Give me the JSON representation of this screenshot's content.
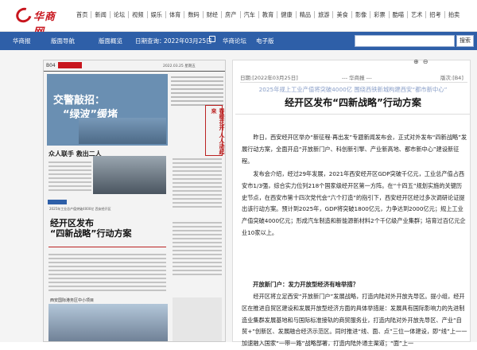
{
  "site": {
    "logo_text": "华商网"
  },
  "top_nav": [
    "首页",
    "新闻",
    "论坛",
    "视频",
    "娱乐",
    "体育",
    "数码",
    "财经",
    "房产",
    "汽车",
    "教育",
    "健康",
    "精品",
    "旅游",
    "美食",
    "影像",
    "彩票",
    "酷喵",
    "艺术",
    "招考",
    "拍卖"
  ],
  "sub_nav": {
    "items": [
      "华商报",
      "版面导航",
      "版面概览"
    ],
    "date_label": "日期查询：",
    "date_value": "2022年03月25日",
    "date_icon": "calendar-icon",
    "links": [
      "华商论坛",
      "电子版"
    ],
    "search_button": "搜索",
    "search_placeholder": ""
  },
  "newspaper": {
    "page_no": "B04",
    "date": "2022.03.25 星期五",
    "story1_title_a": "交警敲招：",
    "story1_title_b": "“绿波”缓堵",
    "side_banner": "春暖花开 人人动起来",
    "story2_title": "众人联手 救出二人",
    "story3_head": "2025年工业总产值突破4000亿 西安经开区",
    "story3_title_a": "经开区发布",
    "story3_title_b": "“四新战略”行动方案",
    "story4_title": "西安国际港务区中小项目"
  },
  "viewer_controls": [
    "⊕",
    "⊖"
  ],
  "article": {
    "date": "日期:[2022年03月25日]",
    "source": "--- 华商报 ---",
    "page": "版次:[B4]",
    "pretitle": "2025年规上工业产值将突破4000亿 围绕西铁新城构建西安“都市新中心”",
    "title": "经开区发布“四新战略”行动方案",
    "paragraphs": [
      "昨日，西安经开区举办“新征程·再出发”专题新闻发布会，正式对外发布“四新战略”发展行动方案，全面开启“开放新门户、科创新引擎、产业新高地、都市新中心”建设新征程。",
      "发布会介绍，经过29年发展，2021年西安经开区GDP突破千亿元，工业总产值占西安市1/3强，综合实力位列218个国家级经开区第一方阵。在“十四五”规划实施的关键历史节点，在西安市第十四次党代会“六个打造”的指引下，西安经开区经过多次调研论证提出该行动方案。预计到2025年，GDP将突破1800亿元，力争达到2000亿元；规上工业产值突破4000亿元；形成汽车制造和新能源新材料2个千亿级产业集群；培育过百亿元企业10家以上。",
      "经开区将立足西安“开放新门户”发展战略，打造内陆对外开放先导区。提小组，经开区在推进自贸区建设和发展开放型经济方面的具体举措是：发展具有国际影响力的先进制造业集群发展基地和与国际标准接轨的商贸服务业，打造内陆对外开放先导区、产业“自贸+”创新区、发展融合经济示范区。同时推进“线、面、点”三位一体建设，即“线”上一一加速融入国家“一带一路”战略部署，打造内陆外通主渠道；“面”上一"
    ],
    "subhead": "开放新门户：发力开放型经济有啥举措？"
  }
}
